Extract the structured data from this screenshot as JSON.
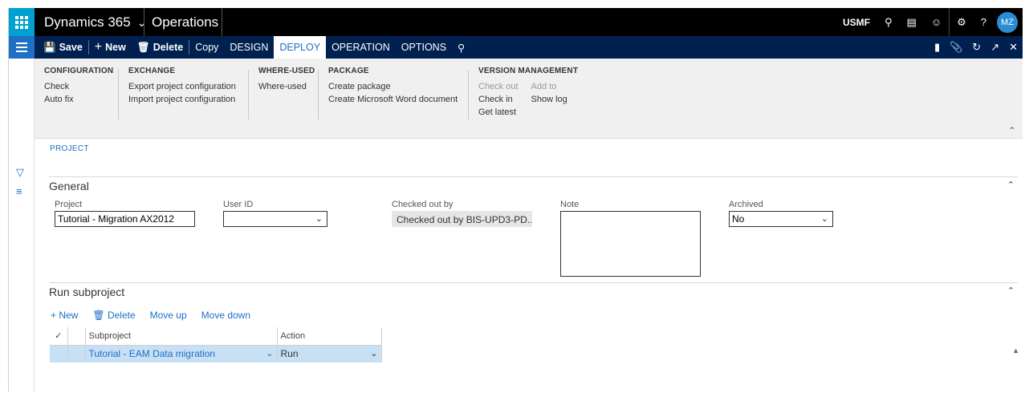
{
  "topbar": {
    "brand": "Dynamics 365",
    "module": "Operations",
    "company": "USMF",
    "avatar_initials": "MZ"
  },
  "actionbar": {
    "save": "Save",
    "new": "New",
    "delete": "Delete",
    "copy": "Copy",
    "tabs": [
      "DESIGN",
      "DEPLOY",
      "OPERATION",
      "OPTIONS"
    ],
    "active_tab": "DEPLOY"
  },
  "ribbon": {
    "groups": [
      {
        "header": "CONFIGURATION",
        "items": [
          "Check",
          "Auto fix"
        ]
      },
      {
        "header": "EXCHANGE",
        "items": [
          "Export project configuration",
          "Import project configuration"
        ]
      },
      {
        "header": "WHERE-USED",
        "items": [
          "Where-used"
        ]
      },
      {
        "header": "PACKAGE",
        "items": [
          "Create package",
          "Create Microsoft Word document"
        ]
      },
      {
        "header": "VERSION MANAGEMENT",
        "items": [
          "Check out",
          "Check in",
          "Get latest",
          "Add to",
          "Show log"
        ]
      }
    ]
  },
  "content": {
    "project_label": "PROJECT",
    "general": {
      "title": "General",
      "project_label": "Project",
      "project_value": "Tutorial - Migration AX2012",
      "userid_label": "User ID",
      "userid_value": "",
      "checkedout_label": "Checked out by",
      "checkedout_value": "Checked out by BIS-UPD3-PD...",
      "note_label": "Note",
      "archived_label": "Archived",
      "archived_value": "No"
    },
    "run_subproject": {
      "title": "Run subproject",
      "tools": {
        "new": "New",
        "delete": "Delete",
        "move_up": "Move up",
        "move_down": "Move down"
      },
      "columns": [
        "Subproject",
        "Action"
      ],
      "rows": [
        {
          "subproject": "Tutorial - EAM Data migration",
          "action": "Run"
        }
      ]
    }
  }
}
